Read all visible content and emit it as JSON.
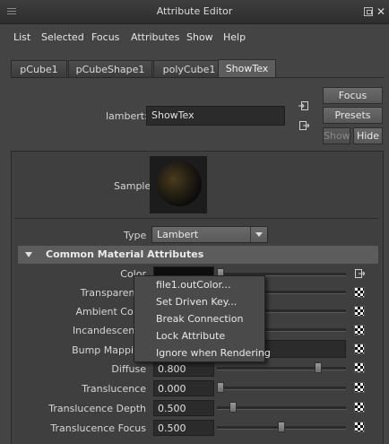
{
  "window": {
    "title": "Attribute Editor"
  },
  "menu": [
    "List",
    "Selected",
    "Focus",
    "Attributes",
    "Show",
    "Help"
  ],
  "tabs": [
    "pCube1",
    "pCubeShape1",
    "polyCube1",
    "ShowTex"
  ],
  "node": {
    "type_label": "lambert:",
    "name": "ShowTex"
  },
  "buttons": {
    "focus": "Focus",
    "presets": "Presets",
    "show": "Show",
    "hide": "Hide"
  },
  "sample": {
    "label": "Sample"
  },
  "type": {
    "label": "Type",
    "value": "Lambert"
  },
  "section": {
    "title": "Common Material Attributes"
  },
  "attributes": [
    {
      "label": "Color"
    },
    {
      "label": "Transparency"
    },
    {
      "label": "Ambient Color"
    },
    {
      "label": "Incandescence"
    },
    {
      "label": "Bump Mapping"
    },
    {
      "label": "Diffuse",
      "value": "0.800"
    },
    {
      "label": "Translucence",
      "value": "0.000"
    },
    {
      "label": "Translucence Depth",
      "value": "0.500"
    },
    {
      "label": "Translucence Focus",
      "value": "0.500"
    }
  ],
  "slider_levels": {
    "diffuse": 0.8,
    "translucence": 0.0,
    "translucence_depth": 0.1,
    "translucence_focus": 0.5
  },
  "context_menu": [
    "file1.outColor...",
    "Set Driven Key...",
    "Break Connection",
    "Lock Attribute",
    "Ignore when Rendering"
  ],
  "colors": {
    "background": "#444444",
    "field": "#2b2b2b",
    "section_header": "#5c5c5c"
  }
}
